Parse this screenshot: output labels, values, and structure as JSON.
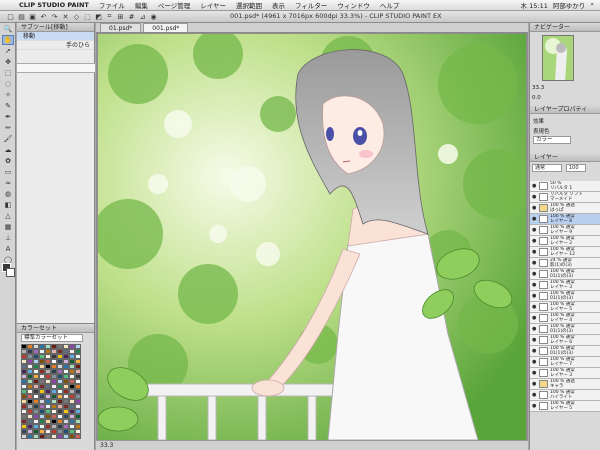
{
  "menubar": {
    "app_name": "CLIP STUDIO PAINT",
    "items": [
      "ファイル",
      "編集",
      "ページ管理",
      "レイヤー",
      "選択範囲",
      "表示",
      "フィルター",
      "ウィンドウ",
      "ヘルプ"
    ],
    "time": "木 15:11",
    "user": "阿部ゆかり"
  },
  "window": {
    "title": "CLIP STUDIO PAINT EX",
    "doc_status": "001.psd* (4961 x 7016px 600dpi 33.3%) - CLIP STUDIO PAINT EX"
  },
  "subtool": {
    "header": "サブツール[移動]",
    "items": [
      "移動",
      "手のひら"
    ]
  },
  "colorset": {
    "header": "カラーセット",
    "selected_set": "標準カラーセット"
  },
  "tabs": [
    {
      "label": "01.psd*"
    },
    {
      "label": "001.psd*"
    }
  ],
  "canvas": {
    "zoom": "33.3"
  },
  "navigator": {
    "header": "ナビゲーター",
    "zoom_value": "33.3",
    "angle_value": "0.0"
  },
  "layer_property": {
    "header": "レイヤープロパティ",
    "effect_label": "効果",
    "expression_label": "表現色",
    "expression_value": "カラー"
  },
  "layer_panel": {
    "header": "レイヤー",
    "blend_mode": "通常",
    "opacity": "100",
    "layers": [
      {
        "name": "50 %\nリバルタ 1",
        "folder": false
      },
      {
        "name": "リバルタ ソフト\nマーメイド",
        "folder": false
      },
      {
        "name": "100 % 通過\nはっぱ",
        "folder": true
      },
      {
        "name": "100 % 通常\nレイヤー 8",
        "folder": false
      },
      {
        "name": "100 % 通常\nレイヤー 9",
        "folder": false
      },
      {
        "name": "100 % 通常\nレイヤー 2",
        "folder": false
      },
      {
        "name": "100 % 通常\nレイヤー 12",
        "folder": false
      },
      {
        "name": "24 % 通常\n影(1)の(3)",
        "folder": false
      },
      {
        "name": "100 % 通常\n01(1)の(3)",
        "folder": false
      },
      {
        "name": "100 % 通常\nレイヤー 3",
        "folder": false
      },
      {
        "name": "100 % 通常\n01(1)の(3)",
        "folder": false
      },
      {
        "name": "100 % 通常\nレイヤー 5",
        "folder": false
      },
      {
        "name": "100 % 通常\nレイヤー 4",
        "folder": false
      },
      {
        "name": "100 % 通常\n01(1)の(3)",
        "folder": false
      },
      {
        "name": "100 % 通常\nレイヤー 6",
        "folder": false
      },
      {
        "name": "100 % 通常\n01(1)の(3)",
        "folder": false
      },
      {
        "name": "100 % 通常\nレイヤー 7",
        "folder": false
      },
      {
        "name": "100 % 通常\nレイヤー 3",
        "folder": false
      },
      {
        "name": "100 % 通過\nキャラ",
        "folder": true
      },
      {
        "name": "100 % 通常\nハイライト",
        "folder": false
      },
      {
        "name": "100 % 通常\nレイヤー 5",
        "folder": false
      }
    ]
  },
  "colors": {
    "accent": "#5a7fb5",
    "selection": "#b9cfee"
  }
}
